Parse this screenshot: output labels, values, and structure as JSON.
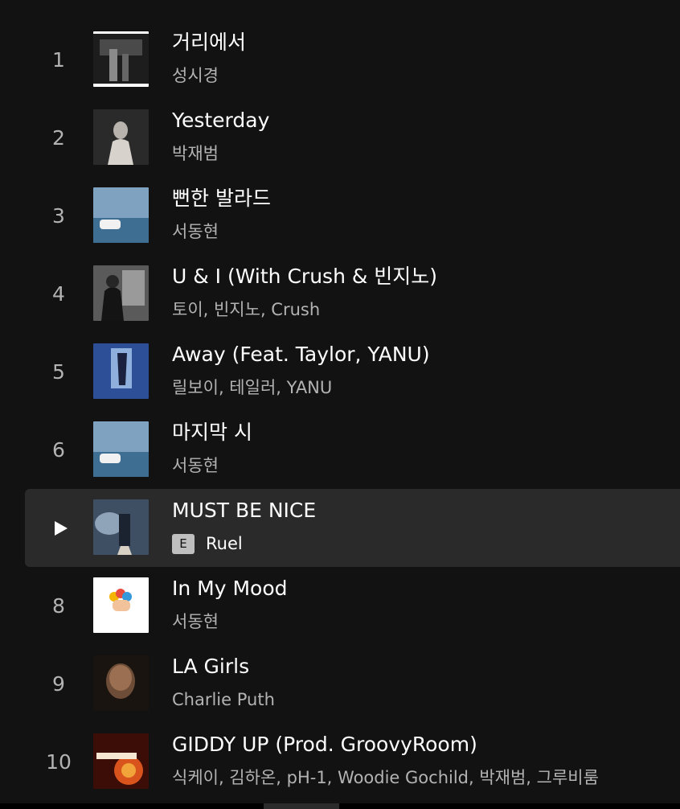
{
  "tracks": [
    {
      "number": "1",
      "title": "거리에서",
      "artist": "성시경",
      "explicit": false,
      "playing": false
    },
    {
      "number": "2",
      "title": "Yesterday",
      "artist": "박재범",
      "explicit": false,
      "playing": false
    },
    {
      "number": "3",
      "title": "뻔한 발라드",
      "artist": "서동현",
      "explicit": false,
      "playing": false
    },
    {
      "number": "4",
      "title": "U & I (With Crush & 빈지노)",
      "artist": "토이, 빈지노, Crush",
      "explicit": false,
      "playing": false
    },
    {
      "number": "5",
      "title": "Away (Feat. Taylor, YANU)",
      "artist": "릴보이, 테일러, YANU",
      "explicit": false,
      "playing": false
    },
    {
      "number": "6",
      "title": "마지막 시",
      "artist": "서동현",
      "explicit": false,
      "playing": false
    },
    {
      "number": "7",
      "title": "MUST BE NICE",
      "artist": "Ruel",
      "explicit": true,
      "explicit_label": "E",
      "playing": true
    },
    {
      "number": "8",
      "title": "In My Mood",
      "artist": "서동현",
      "explicit": false,
      "playing": false
    },
    {
      "number": "9",
      "title": "LA Girls",
      "artist": "Charlie Puth",
      "explicit": false,
      "playing": false
    },
    {
      "number": "10",
      "title": "GIDDY UP (Prod. GroovyRoom)",
      "artist": "식케이, 김하온, pH-1, Woodie Gochild, 박재범, 그루비룸",
      "explicit": false,
      "playing": false
    }
  ],
  "icons": {
    "play": "play-icon",
    "cover": "album-cover"
  },
  "colors": {
    "background": "#121212",
    "active_row": "#2a2a2a",
    "primary_text": "#ffffff",
    "secondary_text": "#b3b3b3",
    "explicit_badge": "#bfbfbf"
  }
}
